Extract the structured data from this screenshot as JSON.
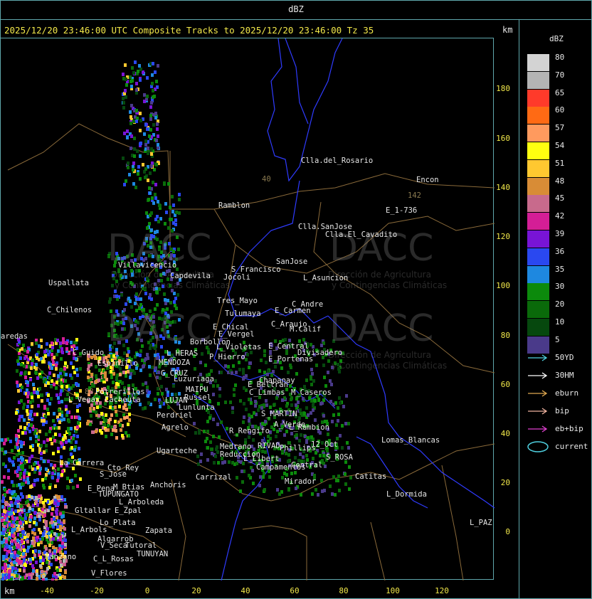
{
  "top_title": "dBZ",
  "header": {
    "text": "2025/12/20 23:46:00 UTC Composite Tracks to 2025/12/20 23:46:00 Tz 35",
    "km_top": "km",
    "km_bottom": "km"
  },
  "colors": {
    "frame": "#5fa7ac",
    "tick_text": "#f2e84a",
    "border_blue": "#2f3bff",
    "border_brown": "#8a6a3a"
  },
  "axes": {
    "y_ticks": [
      "180",
      "160",
      "140",
      "120",
      "100",
      "80",
      "60",
      "40",
      "20",
      "0"
    ],
    "x_ticks": [
      "-40",
      "-20",
      "0",
      "20",
      "40",
      "60",
      "80",
      "100",
      "120"
    ]
  },
  "places": [
    "Clla.del_Rosario",
    "Encon",
    "142",
    "E_1-736",
    "Ramblon",
    "Clla.SanJose",
    "Clla.El_Cavadito",
    "Villavicencio",
    "Capdevila",
    "S_Francisco",
    "SanJose",
    "L_Asuncion",
    "Jocoli",
    "Uspallata",
    "Tres_Mayo",
    "C_Andre",
    "E_Carmen",
    "C_Chilenos",
    "Tulumaya",
    "E_Chical",
    "C_Araujo",
    "M.Calif",
    "E_Vergel",
    "Borbollon",
    "L_Violetas",
    "E_Central",
    "Divisadero",
    "C_Guido",
    "L_HERAS",
    "P_Hierro",
    "E_Portenas",
    "MENDOZA",
    "G_CRUZ",
    "Luzuriaga",
    "Chapanay",
    "MAIPU",
    "E_Beltran",
    "Potrerillos",
    "Russel",
    "C_Limbas",
    "M_Caseros",
    "L_Vegas",
    "Cacheuta",
    "LUJAN",
    "Lunlunta",
    "Perdriel",
    "S_MARTIN",
    "Agrelo",
    "R_Rengifo",
    "A_Verde",
    "L_Rambion",
    "Ugarteche",
    "Medrano",
    "RIVAD",
    "Phillips",
    "12_Oct",
    "Reduccion",
    "Lomas_Blancas",
    "L_Libert",
    "S_ROSA",
    "La_Carrera",
    "Cto_Rey",
    "S_Jose",
    "Campamentos",
    "Central",
    "Catitas",
    "Carrizal",
    "Anchoris",
    "E_Pena",
    "M_Btias",
    "TUPUNGATO",
    "Mirador",
    "L_Dormida",
    "L_Arboleda",
    "Gltallar",
    "E_Zpal",
    "Lo_Plata",
    "L_Arbols",
    "Zapata",
    "V_Seca",
    "Algarrob",
    "Tutoral",
    "TUNUYAN",
    "Manzano",
    "C_L_Rosas",
    "V_Flores",
    "L_PAZ",
    "aredas",
    "Espinillo",
    "88",
    "40"
  ],
  "watermarks": [
    "DACC",
    "Dirección de Agricultura",
    "y Contingencias Climáticas"
  ],
  "legend": {
    "title": "dBZ",
    "scale": [
      {
        "label": "80",
        "color": "#d3d3d3"
      },
      {
        "label": "70",
        "color": "#b4b4b4"
      },
      {
        "label": "65",
        "color": "#ff3a2a"
      },
      {
        "label": "60",
        "color": "#ff6a14"
      },
      {
        "label": "57",
        "color": "#ff9a5e"
      },
      {
        "label": "54",
        "color": "#ffff10"
      },
      {
        "label": "51",
        "color": "#ffc830"
      },
      {
        "label": "48",
        "color": "#d88c36"
      },
      {
        "label": "45",
        "color": "#c86a8c"
      },
      {
        "label": "42",
        "color": "#d41e96"
      },
      {
        "label": "39",
        "color": "#7814d6"
      },
      {
        "label": "36",
        "color": "#2a48f0"
      },
      {
        "label": "35",
        "color": "#1e88e0"
      },
      {
        "label": "30",
        "color": "#0c8a0c"
      },
      {
        "label": "20",
        "color": "#0a6a0a"
      },
      {
        "label": "10",
        "color": "#06480e"
      },
      {
        "label": "5",
        "color": "#4a3a8a"
      }
    ],
    "tracks": [
      {
        "label": "50YD",
        "color": "#4fd0e0",
        "icon": "arrow-icon"
      },
      {
        "label": "30HM",
        "color": "#ffffff",
        "icon": "arrow-icon"
      },
      {
        "label": "eburn",
        "color": "#e0a850",
        "icon": "arrow-icon"
      },
      {
        "label": "bip",
        "color": "#f0b4a0",
        "icon": "arrow-icon"
      },
      {
        "label": "eb+bip",
        "color": "#e040d0",
        "icon": "arrow-icon"
      },
      {
        "label": "current",
        "color": "#4fd0e0",
        "icon": "ellipse-icon"
      }
    ]
  }
}
